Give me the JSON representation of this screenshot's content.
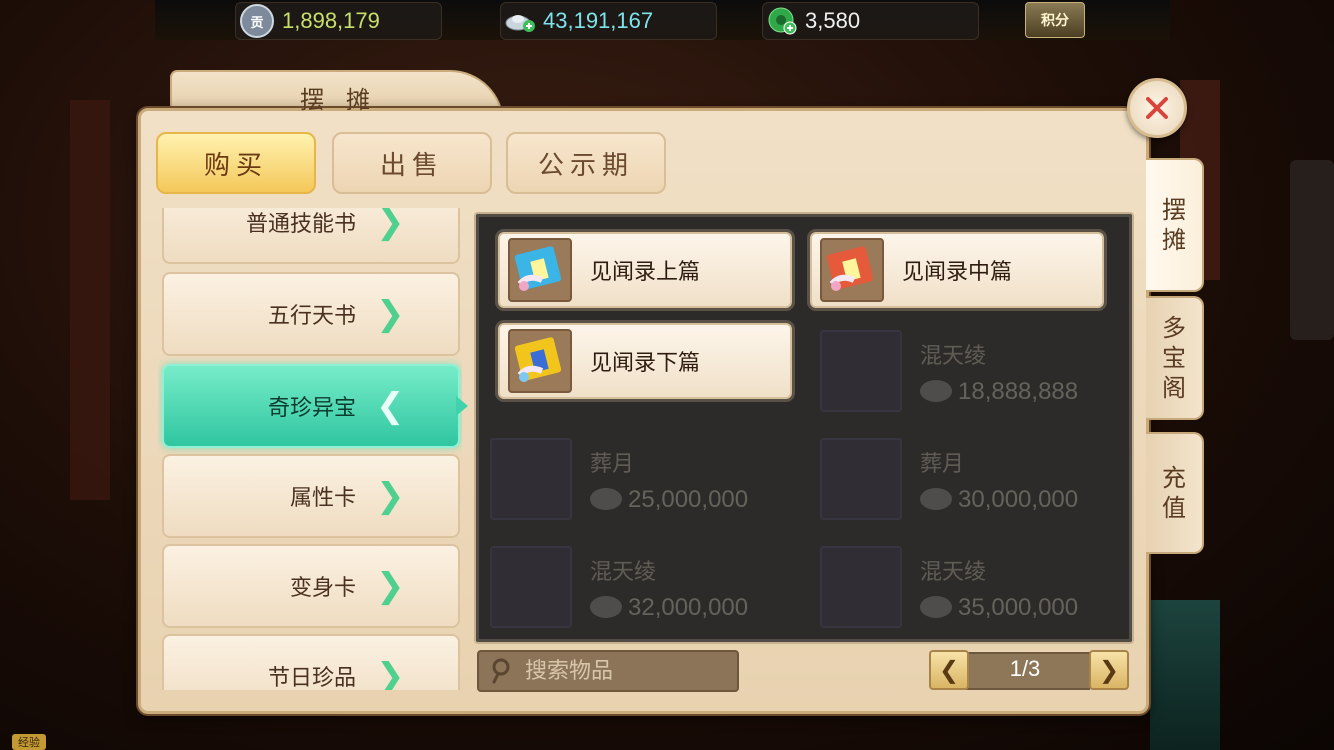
{
  "currencies": [
    {
      "icon": "contribution-coin-icon",
      "icon_char": "贡",
      "value": "1,898,179",
      "color": "#c8e06a",
      "icon_bg": "#7d8a9c"
    },
    {
      "icon": "silver-ingot-icon",
      "icon_char": "",
      "value": "43,191,167",
      "color": "#7fe3ea",
      "icon_bg": "#c7d3da"
    },
    {
      "icon": "jade-icon",
      "icon_char": "",
      "value": "3,580",
      "color": "#f0f0f0",
      "icon_bg": "#3fbf5a"
    }
  ],
  "points_label": "积分",
  "window": {
    "title": "摆摊"
  },
  "tabs": [
    {
      "label": "购买",
      "active": true
    },
    {
      "label": "出售",
      "active": false
    },
    {
      "label": "公示期",
      "active": false
    }
  ],
  "categories": [
    {
      "label": "普通技能书",
      "active": false
    },
    {
      "label": "五行天书",
      "active": false
    },
    {
      "label": "奇珍异宝",
      "active": true
    },
    {
      "label": "属性卡",
      "active": false
    },
    {
      "label": "变身卡",
      "active": false
    },
    {
      "label": "节日珍品",
      "active": false
    }
  ],
  "background_listings": [
    {
      "name": "混天绫",
      "price": "18,888,888"
    },
    {
      "name": "葬月",
      "price": "25,000,000"
    },
    {
      "name": "葬月",
      "price": "30,000,000"
    },
    {
      "name": "混天绫",
      "price": "32,000,000"
    },
    {
      "name": "混天绫",
      "price": "35,000,000"
    }
  ],
  "items": [
    {
      "name": "见闻录上篇",
      "cover_color": "#3bb4e6"
    },
    {
      "name": "见闻录中篇",
      "cover_color": "#e45a3a"
    },
    {
      "name": "见闻录下篇",
      "cover_color": "#f2c51c"
    }
  ],
  "search": {
    "placeholder": "搜索物品"
  },
  "pager": {
    "text": "1/3"
  },
  "side_tabs": [
    {
      "label": "摆摊",
      "chars": [
        "摆",
        "摊"
      ],
      "active": true
    },
    {
      "label": "多宝阁",
      "chars": [
        "多",
        "宝",
        "阁"
      ],
      "active": false
    },
    {
      "label": "充值",
      "chars": [
        "充",
        "值"
      ],
      "active": false
    }
  ],
  "bottom_label": "经验"
}
